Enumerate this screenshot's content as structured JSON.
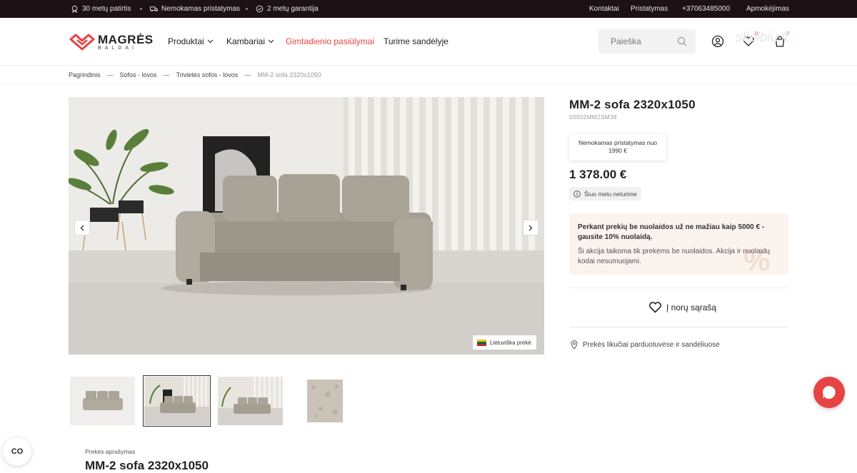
{
  "topbar": {
    "features": [
      {
        "icon": "award-icon",
        "label": "30 metų patirtis"
      },
      {
        "icon": "truck-icon",
        "label": "Nemokamas pristatymas"
      },
      {
        "icon": "shield-check-icon",
        "label": "2 metų garantija"
      }
    ],
    "links": [
      "Kontaktai",
      "Pristatymas",
      "+37063485000",
      "Apmokėjimas"
    ]
  },
  "header": {
    "logo_text": "MAGRĖS",
    "logo_sub": "BALDAI",
    "nav": [
      {
        "label": "Produktai",
        "dropdown": true
      },
      {
        "label": "Kambariai",
        "dropdown": true
      },
      {
        "label": "Gimtadienio pasiūlymai",
        "dropdown": false
      },
      {
        "label": "Turime sandėlyje",
        "dropdown": false
      }
    ],
    "search_placeholder": "Paieška",
    "wishlist_count": "0",
    "cart_count": "0",
    "watermark": "skelbiu.lt"
  },
  "breadcrumb": [
    "Pagrindinis",
    "Sofos - lovos",
    "Trivietės sofos - lovos",
    "MM-2 sofa 2320x1050"
  ],
  "gallery": {
    "origin_badge": "Lietuviška prekė",
    "prev_icon": "chevron-left-icon",
    "next_icon": "chevron-right-icon",
    "thumbnails": 4,
    "active_thumbnail": 2
  },
  "product": {
    "title": "MM-2 sofa 2320x1050",
    "sku": "00002MM2SM38",
    "shipping_note_line1": "Nemokamas pristatymas nuo",
    "shipping_note_line2": "1990 €",
    "price": "1 378.00 €",
    "stock_status": "Šiuo metu neturime",
    "promo_heading": "Perkant prekių be nuolaidos už ne mažiau kaip 5000 € - gausite 10% nuolaidą.",
    "promo_text": "Ši akcija taikoma tik prekėms be nuolaidos. Akcija ir nuolaidų kodai nesumuojami.",
    "promo_symbol": "%",
    "wishlist_label": "Į norų sąrašą",
    "stores_label": "Prekės likučiai parduotuvėse ir sandėliuose"
  },
  "description": {
    "label": "Prekės aprašymas",
    "title": "MM-2 sofa 2320x1050"
  },
  "cookie_button": "CO",
  "colors": {
    "accent": "#e84343",
    "topbar": "#1c1115"
  }
}
